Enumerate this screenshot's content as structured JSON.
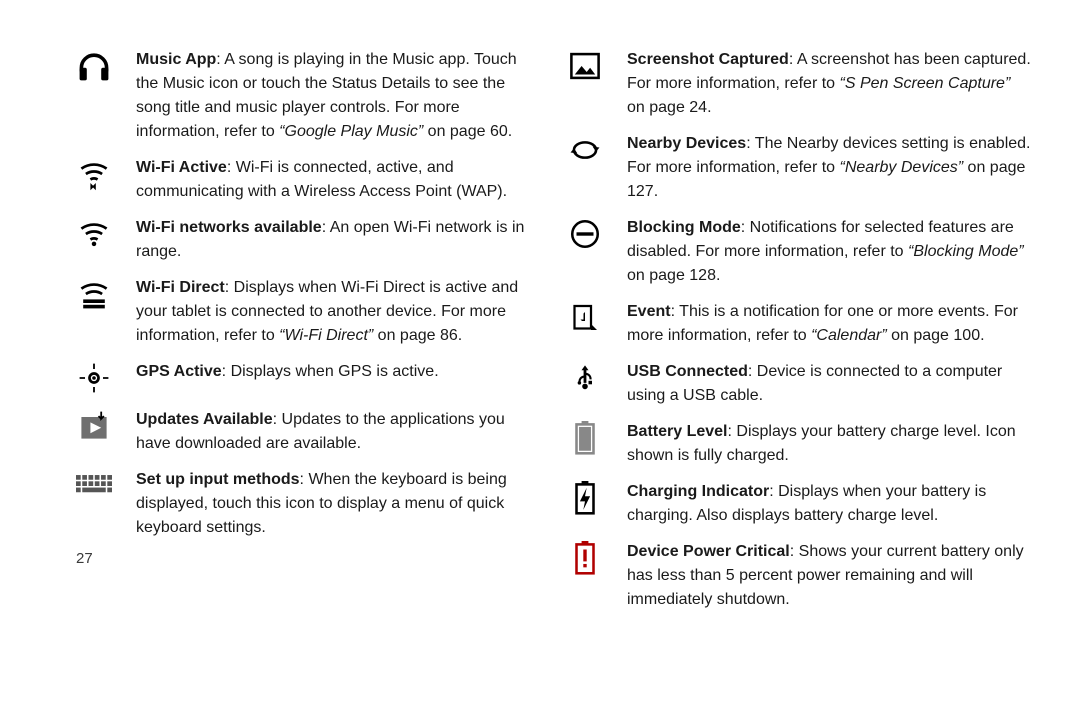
{
  "pageNumber": "27",
  "left": [
    {
      "title": "Music App",
      "body": ": A song is playing in the Music app. Touch the Music icon or touch the Status Details to see the song title and music player controls. For more information, refer to ",
      "ref": "“Google Play Music”",
      "tail": " on page 60."
    },
    {
      "title": "Wi-Fi Active",
      "body": ": Wi-Fi is connected, active, and communicating with a Wireless Access Point (WAP).",
      "ref": "",
      "tail": ""
    },
    {
      "title": "Wi-Fi networks available",
      "body": ": An open Wi-Fi network is in range.",
      "ref": "",
      "tail": ""
    },
    {
      "title": "Wi-Fi Direct",
      "body": ": Displays when Wi-Fi Direct is active and your tablet is connected to another device. For more information, refer to ",
      "ref": "“Wi-Fi Direct”",
      "tail": " on page 86."
    },
    {
      "title": "GPS Active",
      "body": ": Displays when GPS is active.",
      "ref": "",
      "tail": ""
    },
    {
      "title": "Updates Available",
      "body": ": Updates to the applications you have downloaded are available.",
      "ref": "",
      "tail": ""
    },
    {
      "title": "Set up input methods",
      "body": ": When the keyboard is being displayed, touch this icon to display a menu of quick keyboard settings.",
      "ref": "",
      "tail": ""
    }
  ],
  "right": [
    {
      "title": "Screenshot Captured",
      "body": ": A screenshot has been captured. For more information, refer to ",
      "ref": "“S Pen Screen Capture”",
      "tail": " on page 24."
    },
    {
      "title": "Nearby Devices",
      "body": ": The Nearby devices setting is enabled. For more information, refer to ",
      "ref": "“Nearby Devices”",
      "tail": " on page 127."
    },
    {
      "title": "Blocking Mode",
      "body": ": Notifications for selected features are disabled. For more information, refer to ",
      "ref": "“Blocking Mode”",
      "tail": " on page 128."
    },
    {
      "title": "Event",
      "body": ": This is a notification for one or more events. For more information, refer to ",
      "ref": "“Calendar”",
      "tail": " on page 100."
    },
    {
      "title": "USB Connected",
      "body": ": Device is connected to a computer using a USB cable.",
      "ref": "",
      "tail": ""
    },
    {
      "title": "Battery Level",
      "body": ": Displays your battery charge level. Icon shown is fully charged.",
      "ref": "",
      "tail": ""
    },
    {
      "title": "Charging Indicator",
      "body": ": Displays when your battery is charging. Also displays battery charge level.",
      "ref": "",
      "tail": ""
    },
    {
      "title": "Device Power Critical",
      "body": ": Shows your current battery only has less than 5 percent power remaining and will immediately shutdown.",
      "ref": "",
      "tail": ""
    }
  ]
}
